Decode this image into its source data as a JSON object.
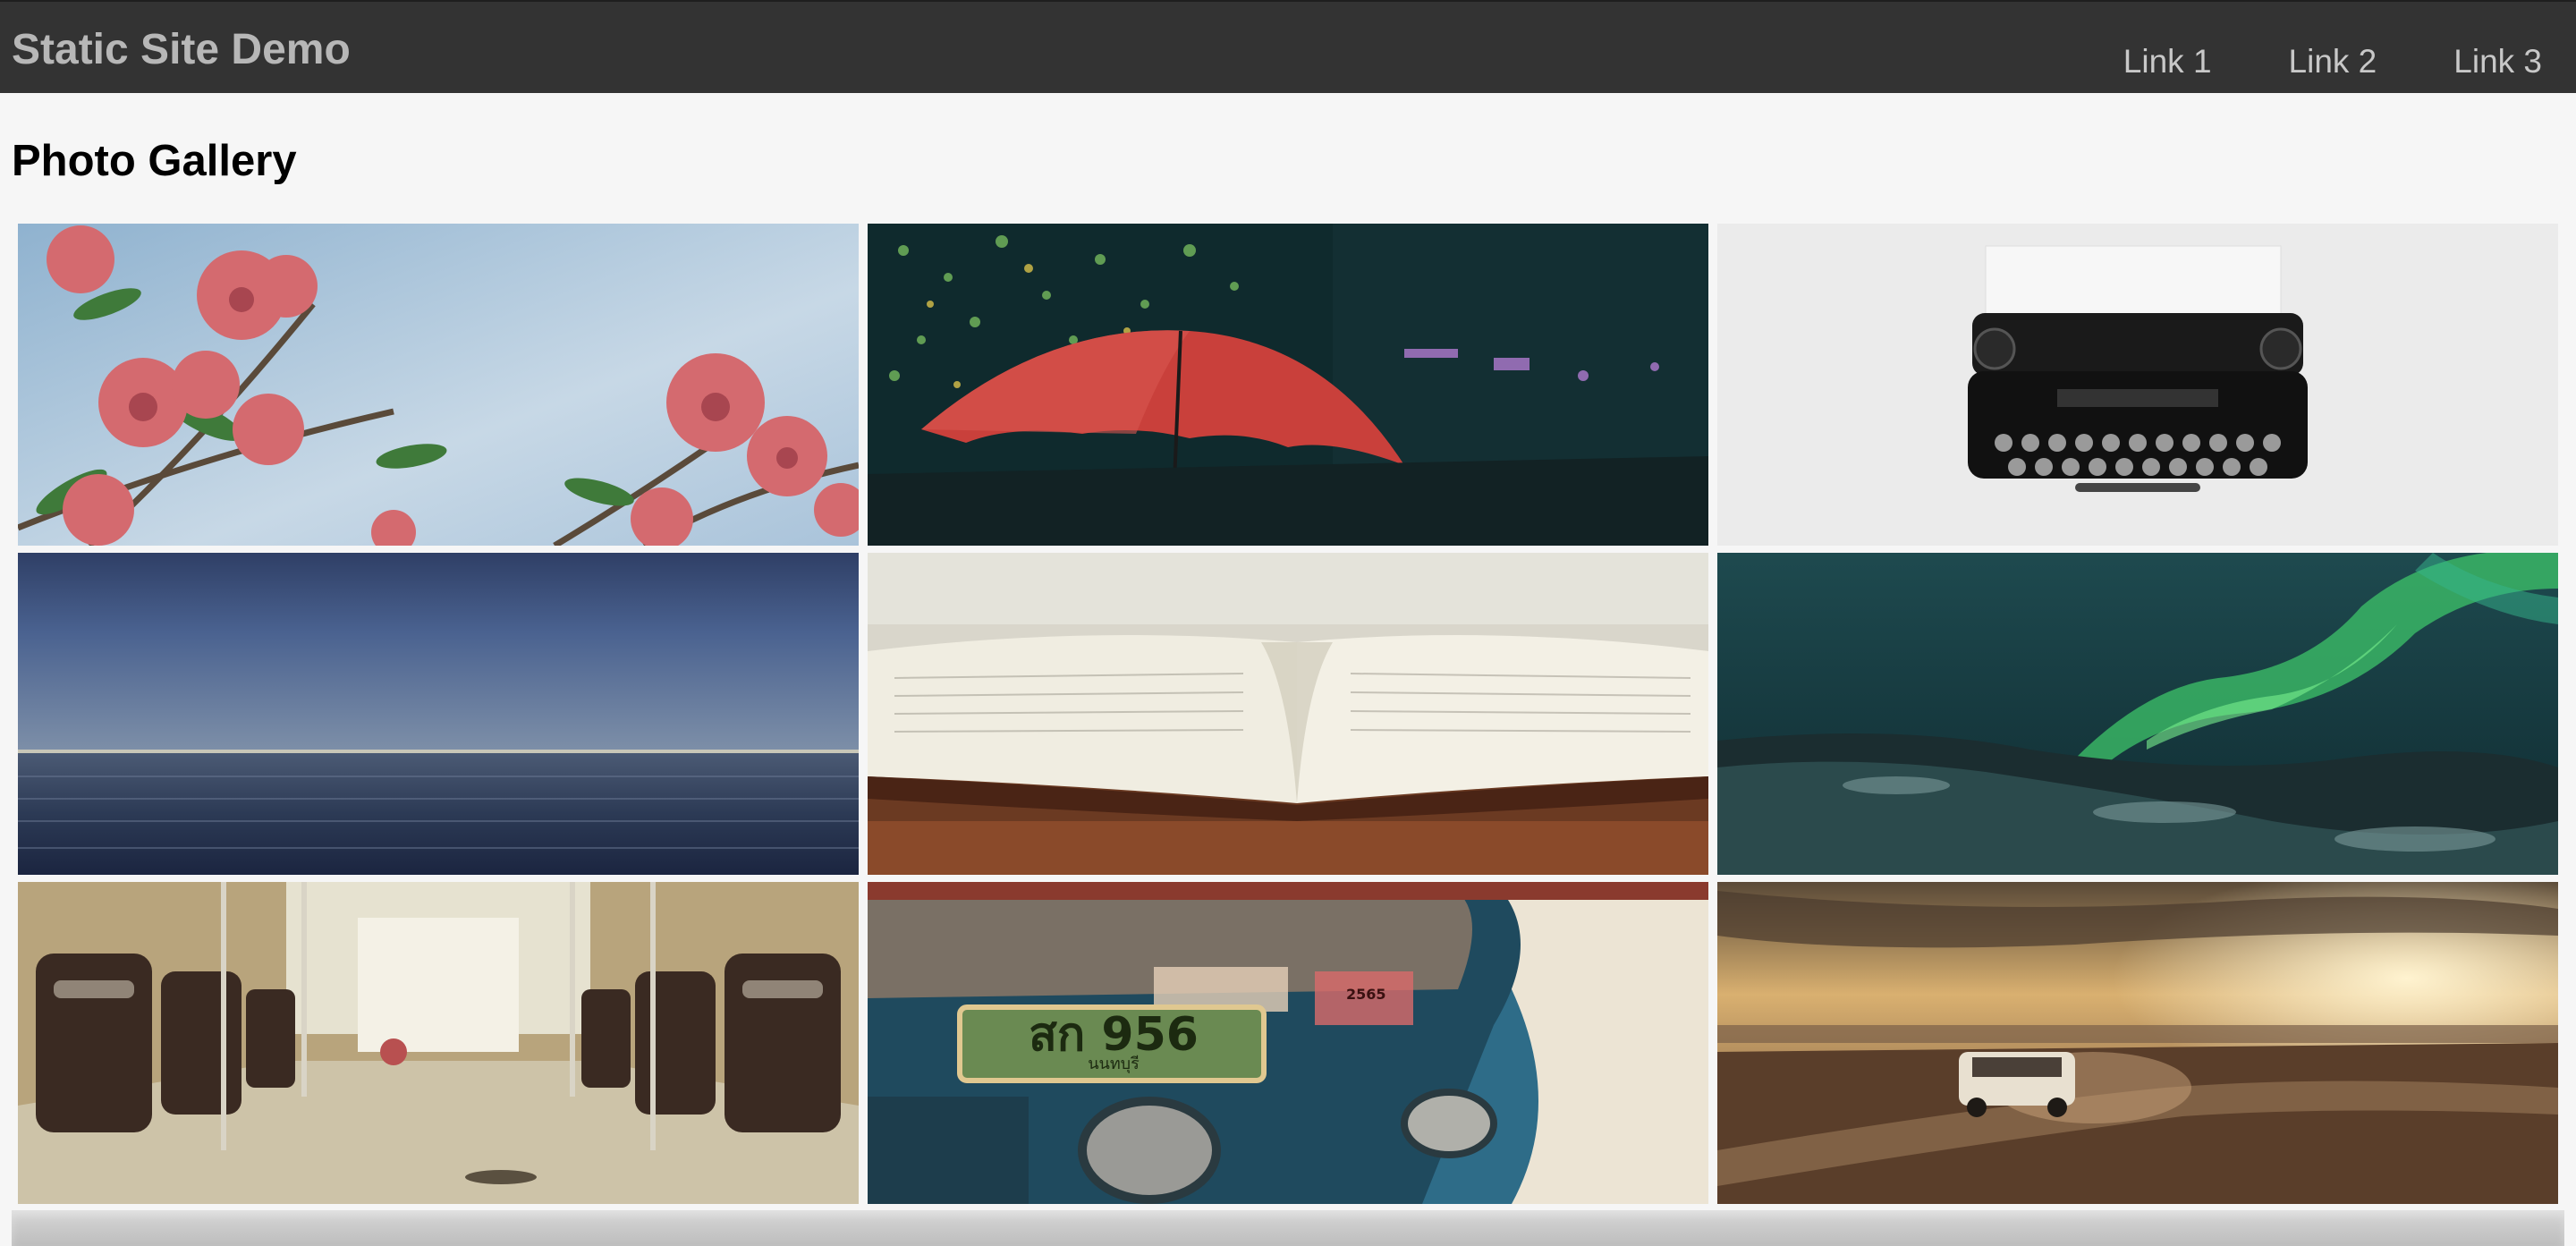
{
  "header": {
    "brand": "Static Site Demo",
    "links": [
      "Link 1",
      "Link 2",
      "Link 3"
    ]
  },
  "main": {
    "title": "Photo Gallery",
    "photos": [
      {
        "name": "pink-flowers-photo",
        "subject": "pink plumeria flowers against sky"
      },
      {
        "name": "red-umbrella-photo",
        "subject": "red umbrella at night with bokeh lights"
      },
      {
        "name": "typewriter-photo",
        "subject": "black vintage typewriter with paper"
      },
      {
        "name": "ocean-horizon-photo",
        "subject": "blue ocean horizon"
      },
      {
        "name": "open-book-photo",
        "subject": "open book on wooden table"
      },
      {
        "name": "aurora-photo",
        "subject": "green aurora over snowy hills"
      },
      {
        "name": "train-interior-photo",
        "subject": "empty train interior seats"
      },
      {
        "name": "tuk-tuk-photo",
        "subject": "tuk tuk with license plate"
      },
      {
        "name": "desert-car-photo",
        "subject": "car driving on dusty road at sunset"
      }
    ],
    "plate_text": "สก 956",
    "plate_sub": "นนทบุรี",
    "plate_sticker": "2565"
  },
  "colors": {
    "navbar": "#333333",
    "brand_text": "#b7b7b7",
    "link_text": "#c8c8c8",
    "background": "#f6f6f6"
  }
}
